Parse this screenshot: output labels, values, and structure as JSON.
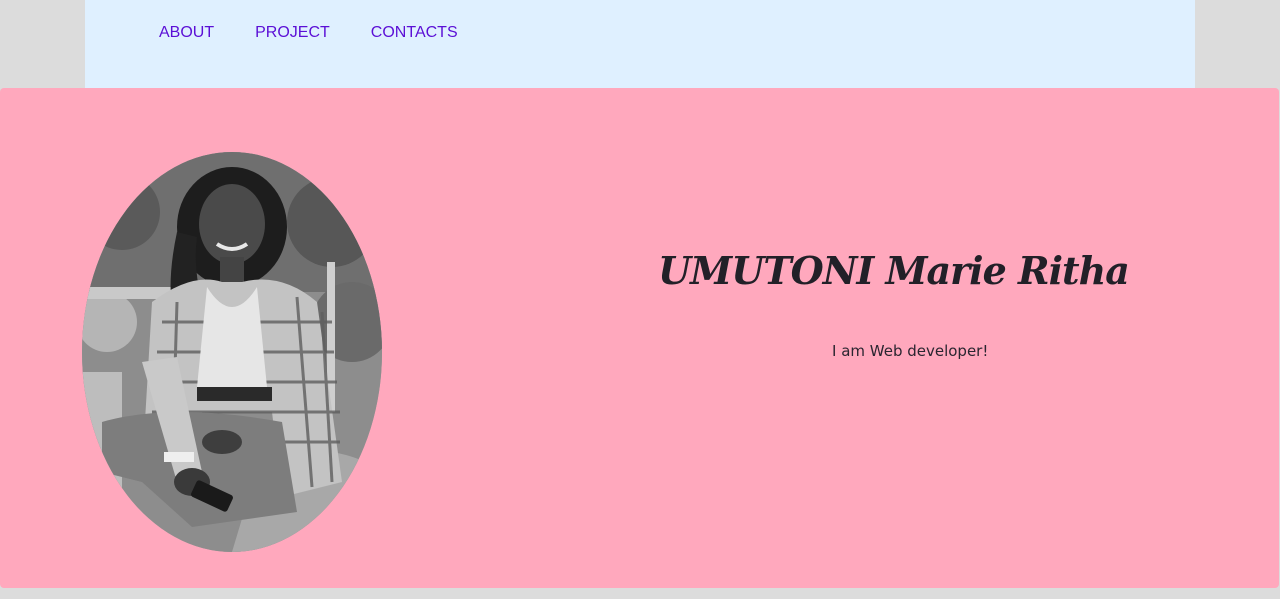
{
  "nav": {
    "items": [
      {
        "label": "ABOUT"
      },
      {
        "label": "PROJECT"
      },
      {
        "label": "CONTACTS"
      }
    ]
  },
  "hero": {
    "name": "UMUTONI Marie Ritha",
    "tagline": "I am Web developer!",
    "photo_alt": "UMUTONI Marie Ritha"
  },
  "colors": {
    "page_bg": "#dcdcdc",
    "nav_bg": "#dff0ff",
    "nav_link": "#5b0fd6",
    "hero_bg": "#ffa8bd",
    "heading": "#222028"
  }
}
